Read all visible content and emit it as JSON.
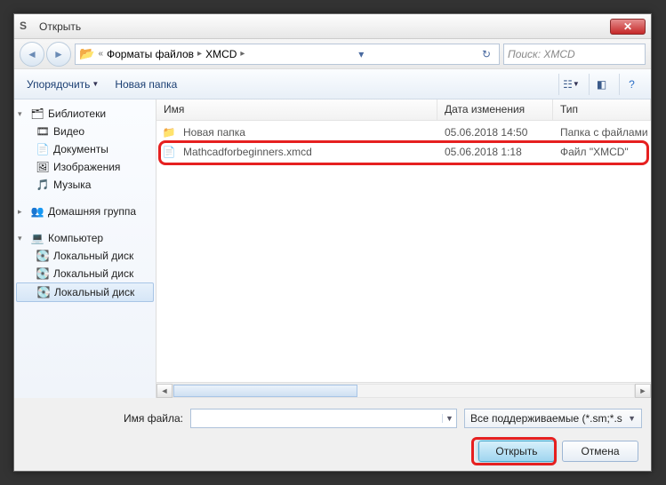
{
  "title": "Открыть",
  "app_icon_letter": "S",
  "breadcrumb": {
    "back_symbol": "«",
    "part1": "Форматы файлов",
    "part2": "XMCD",
    "refresh_symbol": "↻"
  },
  "search": {
    "placeholder": "Поиск: XMCD"
  },
  "toolbar": {
    "organize": "Упорядочить",
    "new_folder": "Новая папка"
  },
  "sidebar": {
    "libraries": "Библиотеки",
    "video": "Видео",
    "documents": "Документы",
    "pictures": "Изображения",
    "music": "Музыка",
    "homegroup": "Домашняя группа",
    "computer": "Компьютер",
    "disk1": "Локальный диск",
    "disk2": "Локальный диск",
    "disk3": "Локальный диск"
  },
  "columns": {
    "name": "Имя",
    "date": "Дата изменения",
    "type": "Тип"
  },
  "files": [
    {
      "name": "Новая папка",
      "date": "05.06.2018 14:50",
      "type": "Папка с файлами",
      "icon": "📁"
    },
    {
      "name": "Mathcadforbeginners.xmcd",
      "date": "05.06.2018 1:18",
      "type": "Файл \"XMCD\"",
      "icon": "📄"
    }
  ],
  "filename_label": "Имя файла:",
  "filter_label": "Все поддерживаемые (*.sm;*.s",
  "buttons": {
    "open": "Открыть",
    "cancel": "Отмена"
  }
}
